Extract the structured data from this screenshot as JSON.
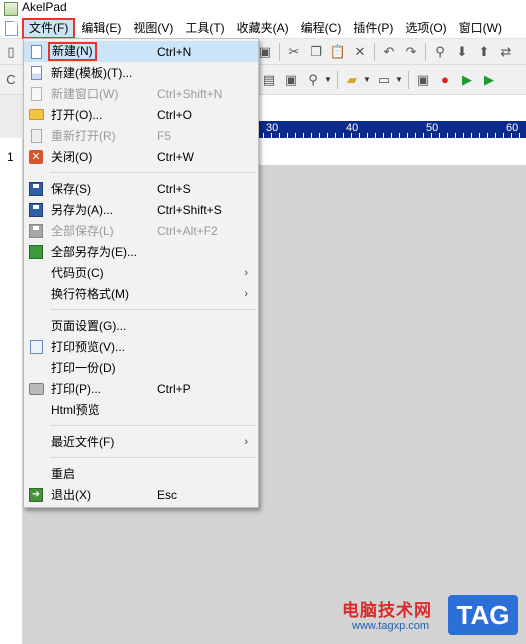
{
  "window": {
    "title": "AkelPad"
  },
  "menubar": {
    "items": [
      {
        "label": "文件(F)"
      },
      {
        "label": "编辑(E)"
      },
      {
        "label": "视图(V)"
      },
      {
        "label": "工具(T)"
      },
      {
        "label": "收藏夹(A)"
      },
      {
        "label": "编程(C)"
      },
      {
        "label": "插件(P)"
      },
      {
        "label": "选项(O)"
      },
      {
        "label": "窗口(W)"
      }
    ]
  },
  "ruler": {
    "labels": [
      "30",
      "40",
      "50",
      "60"
    ]
  },
  "gutter": {
    "line_number": "1"
  },
  "file_menu": {
    "items": [
      {
        "label": "新建(N)",
        "shortcut": "Ctrl+N",
        "icon": "new-document-icon"
      },
      {
        "label": "新建(模板)(T)...",
        "shortcut": "",
        "icon": "template-icon"
      },
      {
        "label": "新建窗口(W)",
        "shortcut": "Ctrl+Shift+N",
        "icon": "new-window-icon",
        "disabled": true
      },
      {
        "label": "打开(O)...",
        "shortcut": "Ctrl+O",
        "icon": "folder-icon"
      },
      {
        "label": "重新打开(R)",
        "shortcut": "F5",
        "icon": "reopen-icon",
        "disabled": true
      },
      {
        "label": "关闭(O)",
        "shortcut": "Ctrl+W",
        "icon": "close-icon"
      },
      {
        "label": "保存(S)",
        "shortcut": "Ctrl+S",
        "icon": "save-icon"
      },
      {
        "label": "另存为(A)...",
        "shortcut": "Ctrl+Shift+S",
        "icon": "save-as-icon"
      },
      {
        "label": "全部保存(L)",
        "shortcut": "Ctrl+Alt+F2",
        "icon": "save-all-icon",
        "disabled": true
      },
      {
        "label": "全部另存为(E)...",
        "shortcut": "",
        "icon": "save-all-as-icon"
      },
      {
        "label": "代码页(C)",
        "shortcut": "",
        "submenu": true
      },
      {
        "label": "换行符格式(M)",
        "shortcut": "",
        "submenu": true
      },
      {
        "label": "页面设置(G)...",
        "shortcut": ""
      },
      {
        "label": "打印预览(V)...",
        "shortcut": "",
        "icon": "print-preview-icon"
      },
      {
        "label": "打印一份(D)",
        "shortcut": ""
      },
      {
        "label": "打印(P)...",
        "shortcut": "Ctrl+P",
        "icon": "printer-icon"
      },
      {
        "label": "Html预览",
        "shortcut": ""
      },
      {
        "label": "最近文件(F)",
        "shortcut": "",
        "submenu": true
      },
      {
        "label": "重启",
        "shortcut": ""
      },
      {
        "label": "退出(X)",
        "shortcut": "Esc",
        "icon": "exit-icon"
      }
    ],
    "submenu_arrow": "›"
  },
  "watermark": {
    "text": "电脑技术网",
    "url": "www.tagxp.com",
    "badge": "TAG"
  },
  "colors": {
    "highlight_border": "#e8352c",
    "ruler_bg": "#0b2a8a",
    "editor_bg": "#d3d3d3"
  }
}
